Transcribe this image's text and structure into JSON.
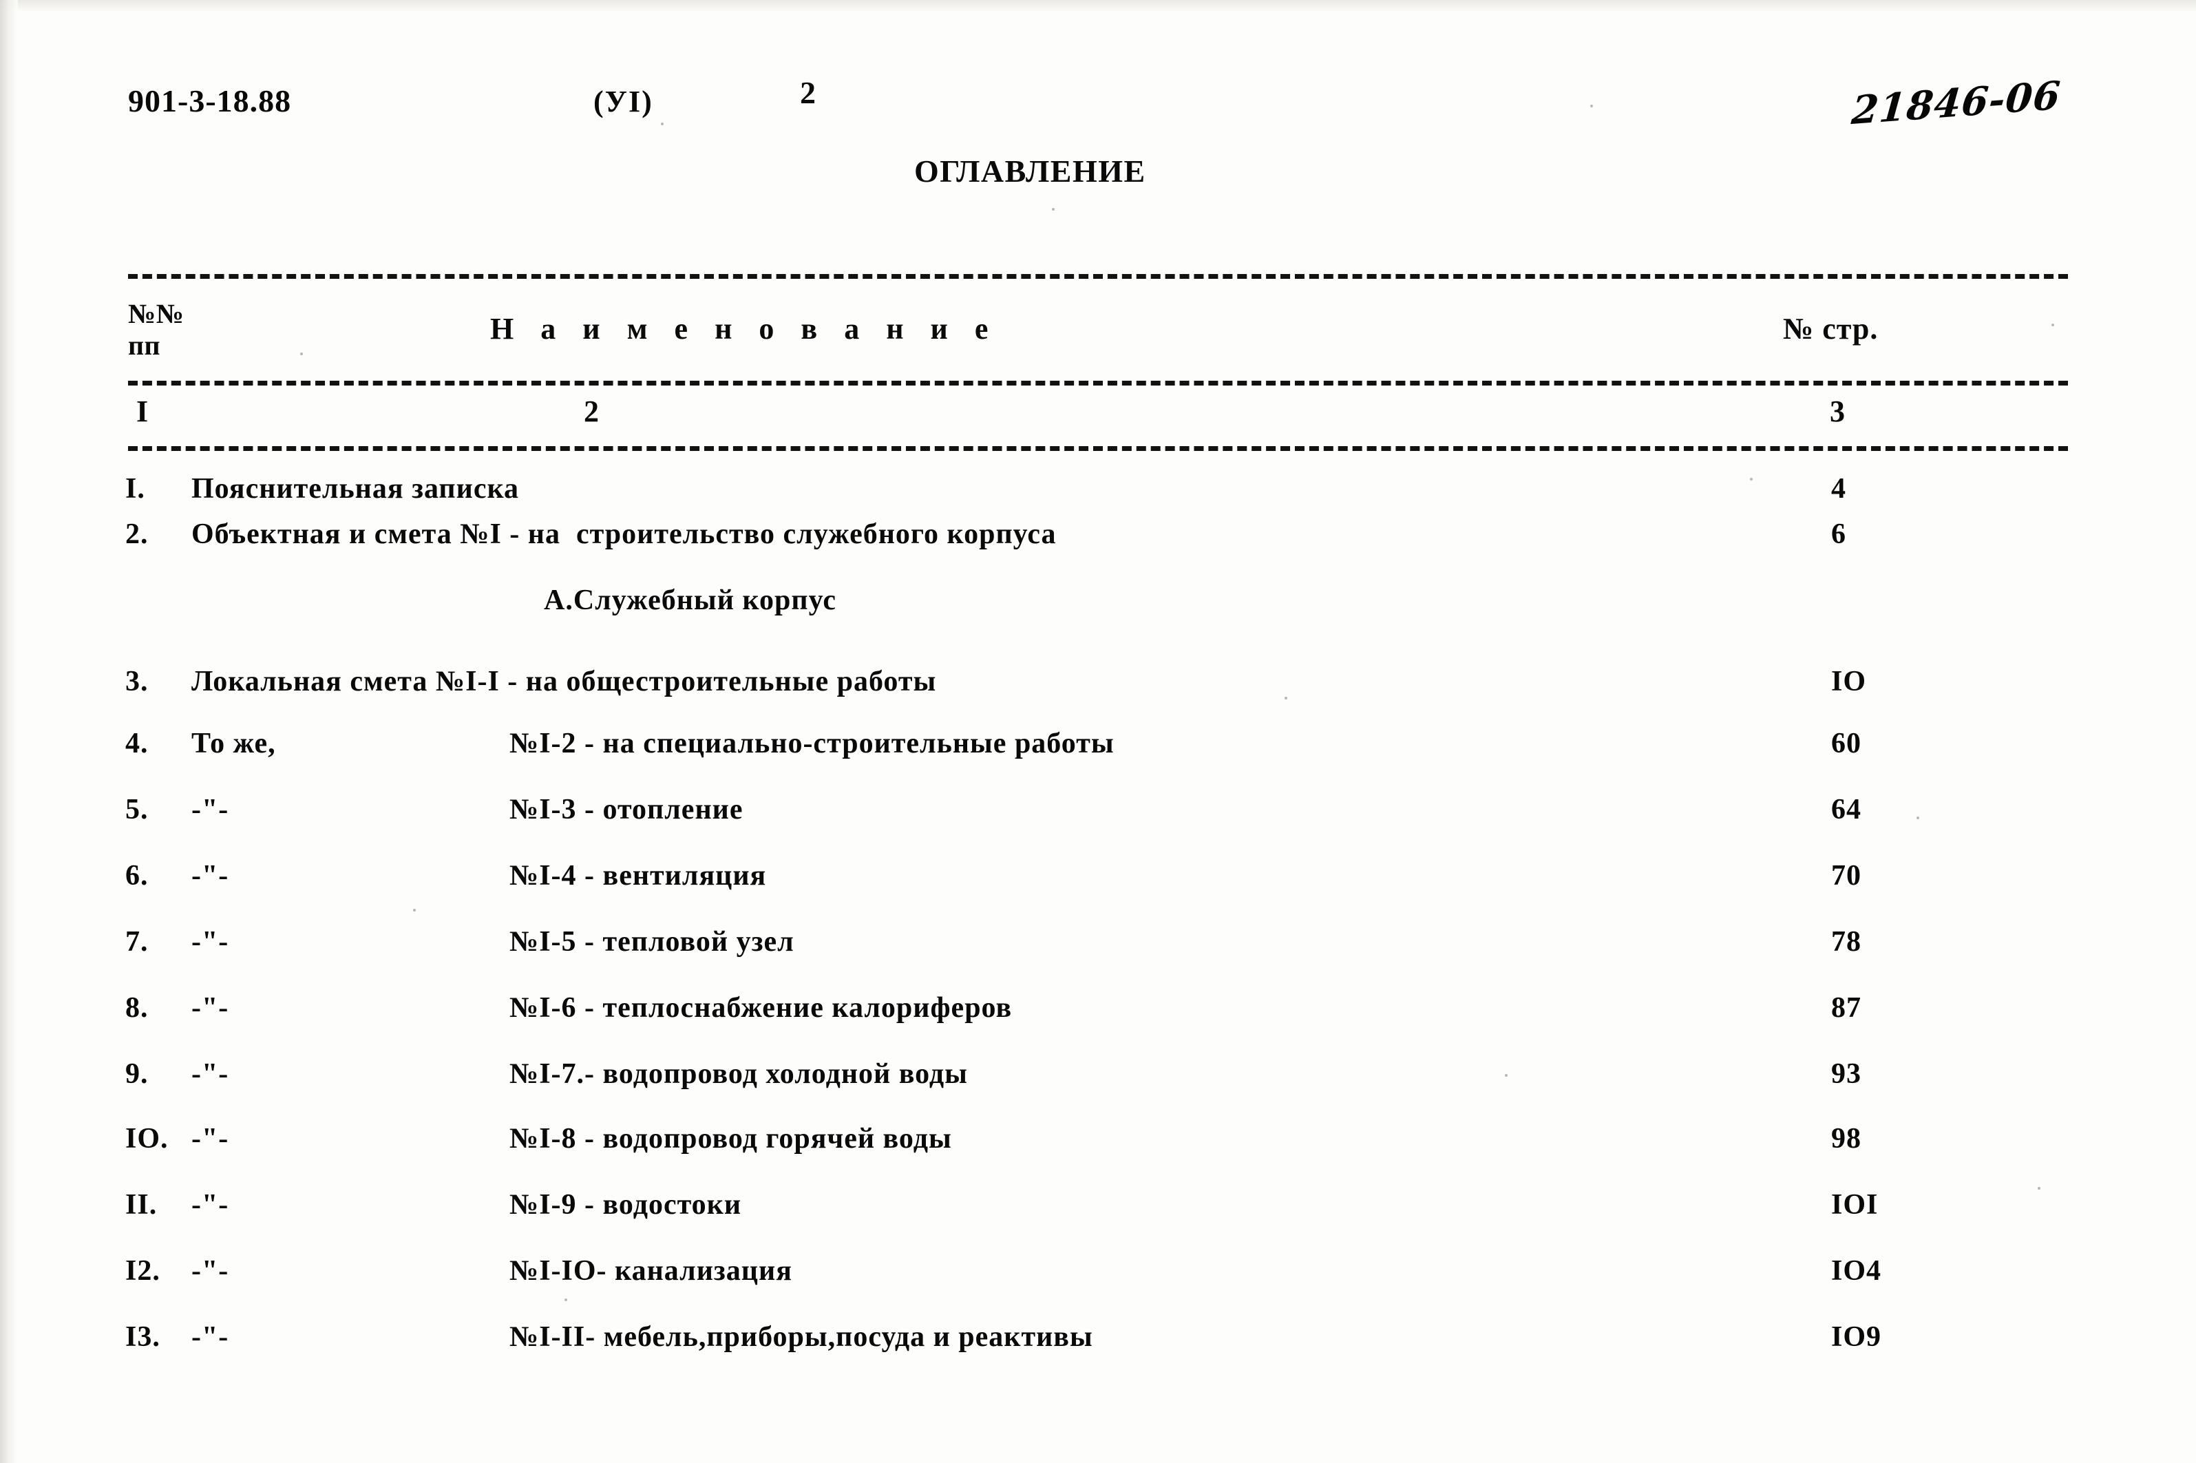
{
  "header": {
    "doc_code": "901-3-18.88",
    "variant": "(УI)",
    "page_number": "2",
    "handwritten_code": "21846-06"
  },
  "title": "ОГЛАВЛЕНИЕ",
  "table": {
    "columns": {
      "no_line1": "№№",
      "no_line2": "пп",
      "name": "Н а и м е н о в а н и е",
      "page": "№ стр."
    },
    "column_index": {
      "first": "I",
      "second": "2",
      "third": "3"
    },
    "rows": [
      {
        "no": "I.",
        "title": "Пояснительная записка",
        "ref": "",
        "page": "4"
      },
      {
        "no": "2.",
        "title": "Объектная и смета №I - на  строительство служебного корпуса",
        "ref": "",
        "page": "6"
      },
      {
        "no": "3.",
        "title": "Локальная смета №I-I - на общестроительные работы",
        "ref": "",
        "page": "IO"
      },
      {
        "no": "4.",
        "title": "То же,",
        "ref": "№I-2 - на специально-строительные работы",
        "page": "60"
      },
      {
        "no": "5.",
        "title": "-\"-",
        "ref": "№I-3 - отопление",
        "page": "64"
      },
      {
        "no": "6.",
        "title": "-\"-",
        "ref": "№I-4 - вентиляция",
        "page": "70"
      },
      {
        "no": "7.",
        "title": "-\"-",
        "ref": "№I-5 - тепловой узел",
        "page": "78"
      },
      {
        "no": "8.",
        "title": "-\"-",
        "ref": "№I-6 - теплоснабжение калориферов",
        "page": "87"
      },
      {
        "no": "9.",
        "title": "-\"-",
        "ref": "№I-7.- водопровод холодной воды",
        "page": "93"
      },
      {
        "no": "IO.",
        "title": "-\"-",
        "ref": "№I-8 - водопровод горячей воды",
        "page": "98"
      },
      {
        "no": "II.",
        "title": "-\"-",
        "ref": "№I-9 - водостоки",
        "page": "IOI"
      },
      {
        "no": "I2.",
        "title": "-\"-",
        "ref": "№I-IO- канализация",
        "page": "IO4"
      },
      {
        "no": "I3.",
        "title": "-\"-",
        "ref": "№I-II- мебель,приборы,посуда и реактивы",
        "page": "IO9"
      }
    ],
    "section_heading": "А.Служебный корпус"
  }
}
